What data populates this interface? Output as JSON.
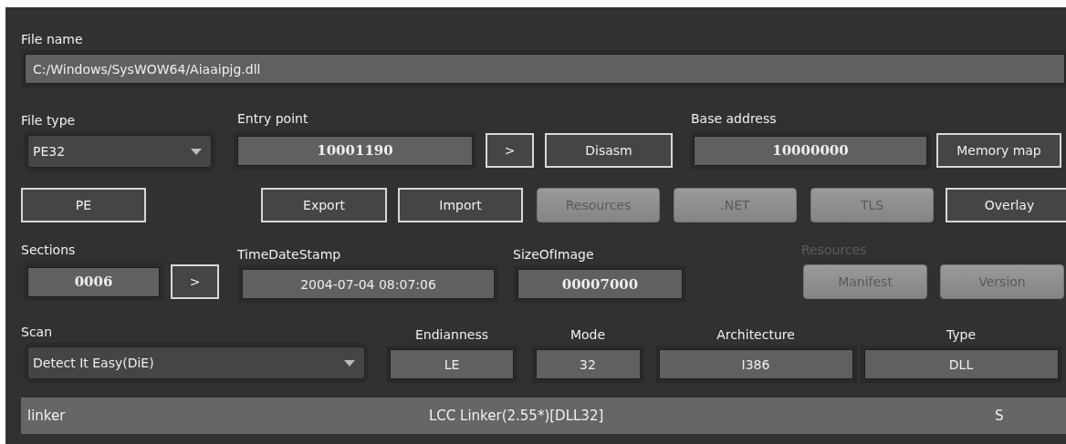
{
  "file_name": {
    "label": "File name",
    "value": "C:/Windows/SysWOW64/Aiaaipjg.dll"
  },
  "file_type": {
    "label": "File type",
    "value": "PE32"
  },
  "entry_point": {
    "label": "Entry point",
    "value": "10001190",
    "buttons": [
      ">",
      "Disasm"
    ]
  },
  "base_address": {
    "label": "Base address",
    "value": "10000000",
    "button": "Memory map"
  },
  "action_buttons": [
    {
      "label": "PE",
      "disabled": false
    },
    {
      "label": "Export",
      "disabled": false
    },
    {
      "label": "Import",
      "disabled": false
    },
    {
      "label": "Resources",
      "disabled": true
    },
    {
      "label": ".NET",
      "disabled": true
    },
    {
      "label": "TLS",
      "disabled": true
    },
    {
      "label": "Overlay",
      "disabled": false
    }
  ],
  "sections": {
    "label": "Sections",
    "value": "0006",
    "button": ">"
  },
  "time_date_stamp": {
    "label": "TimeDateStamp",
    "value": "2004-07-04 08:07:06"
  },
  "size_of_image": {
    "label": "SizeOfImage",
    "value": "00007000"
  },
  "resources": {
    "label": "Resources",
    "disabled": true,
    "buttons": [
      {
        "label": "Manifest",
        "disabled": true
      },
      {
        "label": "Version",
        "disabled": true
      }
    ]
  },
  "scan": {
    "label": "Scan",
    "value": "Detect It Easy(DiE)"
  },
  "info_fields": [
    {
      "label": "Endianness",
      "value": "LE"
    },
    {
      "label": "Mode",
      "value": "32"
    },
    {
      "label": "Architecture",
      "value": "I386"
    },
    {
      "label": "Type",
      "value": "DLL"
    }
  ],
  "result": {
    "type": "linker",
    "name": "LCC Linker(2.55*)[DLL32]",
    "flag": "S"
  }
}
